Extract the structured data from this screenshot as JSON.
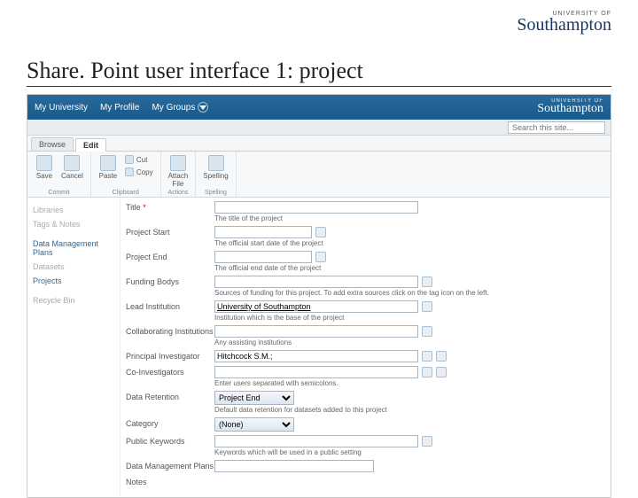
{
  "slide": {
    "logo_small": "UNIVERSITY OF",
    "logo_big": "Southampton",
    "title": "Share. Point user interface 1: project"
  },
  "topnav": {
    "items": [
      "My University",
      "My Profile",
      "My Groups"
    ],
    "brand_small": "UNIVERSITY OF",
    "brand_big": "Southampton"
  },
  "search": {
    "placeholder": "Search this site..."
  },
  "tabs": {
    "browse": "Browse",
    "edit": "Edit"
  },
  "ribbon": {
    "commit": {
      "save": "Save",
      "cancel": "Cancel",
      "label": "Commit"
    },
    "clipboard": {
      "paste": "Paste",
      "cut": "Cut",
      "copy": "Copy",
      "label": "Clipboard"
    },
    "actions": {
      "attach": "Attach\nFile",
      "label": "Actions"
    },
    "spelling": {
      "spelling": "Spelling",
      "label": "Spelling"
    }
  },
  "sidenav": {
    "items": [
      {
        "label": "Libraries",
        "cls": "muted"
      },
      {
        "label": "Tags & Notes",
        "cls": "muted"
      },
      {
        "label": "Data Management Plans",
        "cls": "accent"
      },
      {
        "label": "Datasets",
        "cls": "muted"
      },
      {
        "label": "Projects",
        "cls": "accent"
      },
      {
        "label": "Recycle Bin",
        "cls": "muted"
      }
    ]
  },
  "form": {
    "title": {
      "label": "Title",
      "hint": "The title of the project"
    },
    "start": {
      "label": "Project Start",
      "hint": "The official start date of the project"
    },
    "end": {
      "label": "Project End",
      "hint": "The official end date of the project"
    },
    "funding": {
      "label": "Funding Bodys",
      "hint": "Sources of funding for this project. To add extra sources click on the tag icon on the left."
    },
    "lead": {
      "label": "Lead Institution",
      "value": "University of Southampton",
      "hint": "Institution which is the base of the project"
    },
    "collab": {
      "label": "Collaborating Institutions",
      "hint": "Any assisting institutions"
    },
    "pi": {
      "label": "Principal Investigator",
      "value": "Hitchcock S.M.;"
    },
    "co": {
      "label": "Co-Investigators",
      "hint": "Enter users separated with semicolons."
    },
    "retention": {
      "label": "Data Retention",
      "value": "Project End",
      "hint": "Default data retention for datasets added to this project"
    },
    "category": {
      "label": "Category",
      "value": "(None)"
    },
    "keywords": {
      "label": "Public Keywords",
      "hint": "Keywords which will be used in a public setting"
    },
    "dmp": {
      "label": "Data Management Plans"
    },
    "notes": {
      "label": "Notes"
    }
  }
}
